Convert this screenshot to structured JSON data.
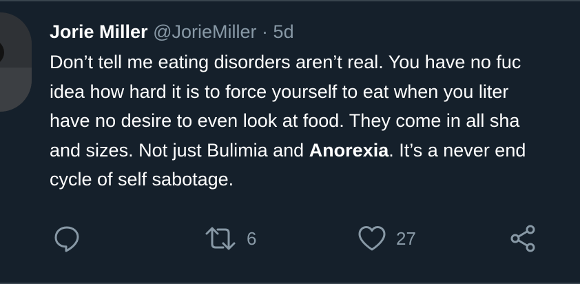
{
  "tweet": {
    "display_name": "Jorie Miller",
    "handle": "@JorieMiller",
    "separator": "·",
    "timestamp": "5d",
    "body": {
      "line1": "Don’t tell me eating disorders aren’t real. You have no fuc",
      "line2": "idea how hard it is to force yourself to eat when you liter",
      "line3": "have no desire to even look at food. They come in all sha",
      "line4_a": "and sizes. Not just Bulimia and ",
      "line4_bold": "Anorexia",
      "line4_b": ". It’s a never end",
      "line5": "cycle of self sabotage."
    }
  },
  "actions": {
    "reply_icon": "reply-icon",
    "retweet_icon": "retweet-icon",
    "retweet_count": "6",
    "like_icon": "heart-icon",
    "like_count": "27",
    "share_icon": "share-icon"
  },
  "colors": {
    "background": "#15202b",
    "text": "#ffffff",
    "secondary": "#8899a6",
    "divider": "#38444d"
  }
}
